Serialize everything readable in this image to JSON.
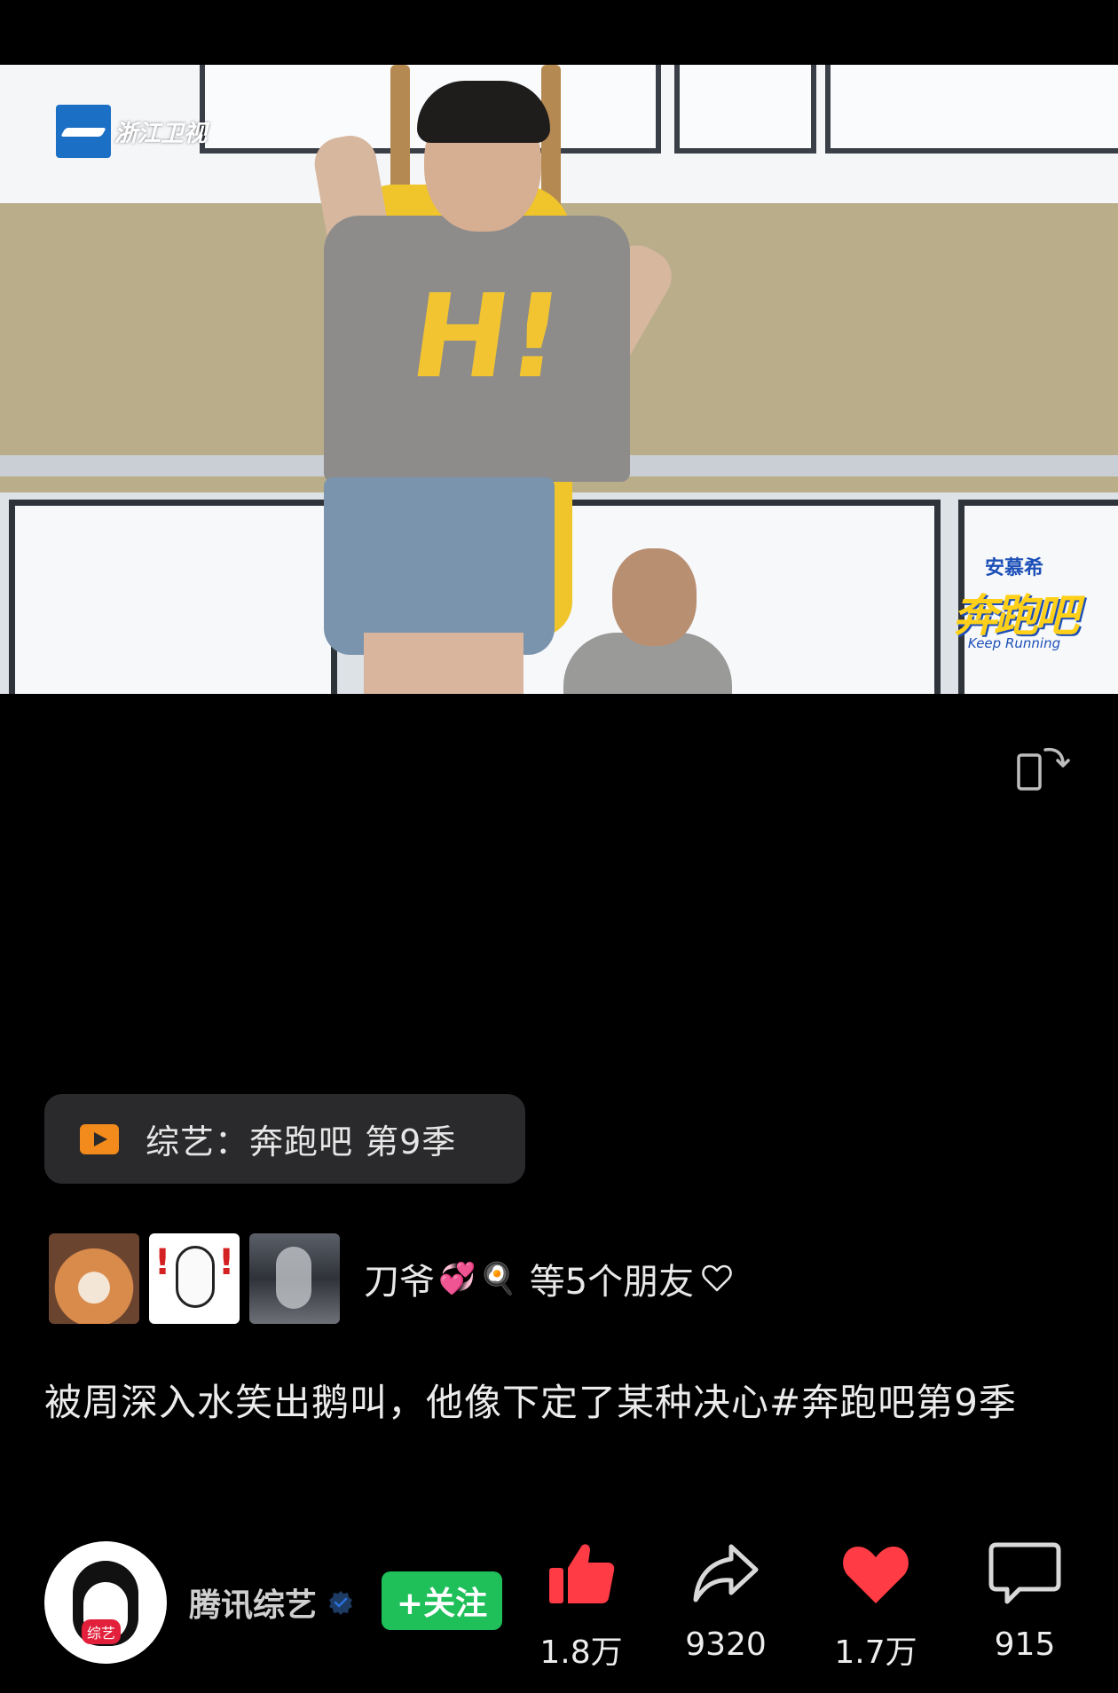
{
  "video": {
    "channel_name": "浙江卫视",
    "show_logo_sponsor": "安慕希",
    "show_logo_title": "奔跑吧",
    "show_logo_sub": "Keep Running",
    "shirt_text": "H!"
  },
  "show_pill": {
    "label": "综艺：奔跑吧 第9季",
    "icon": "play-icon",
    "icon_color": "#f28b1b"
  },
  "friends": {
    "name": "刀爷",
    "emojis": [
      "💞",
      "🍳"
    ],
    "suffix": "等5个朋友",
    "thumbs": [
      "corgi-photo",
      "rice-cartoon",
      "tiger-reflection"
    ]
  },
  "description": "被周深入水笑出鹅叫，他像下定了某种决心#奔跑吧第9季",
  "author": {
    "name": "腾讯综艺",
    "avatar_badge": "综艺",
    "follow_label": "+关注",
    "follow_color": "#1fbf5a"
  },
  "actions": {
    "like": {
      "icon": "thumb-up-icon",
      "count": "1.8万",
      "color": "#ff3b45"
    },
    "share": {
      "icon": "share-icon",
      "count": "9320"
    },
    "favorite": {
      "icon": "heart-icon",
      "count": "1.7万",
      "color": "#ff3b45"
    },
    "comment": {
      "icon": "comment-icon",
      "count": "915"
    }
  }
}
